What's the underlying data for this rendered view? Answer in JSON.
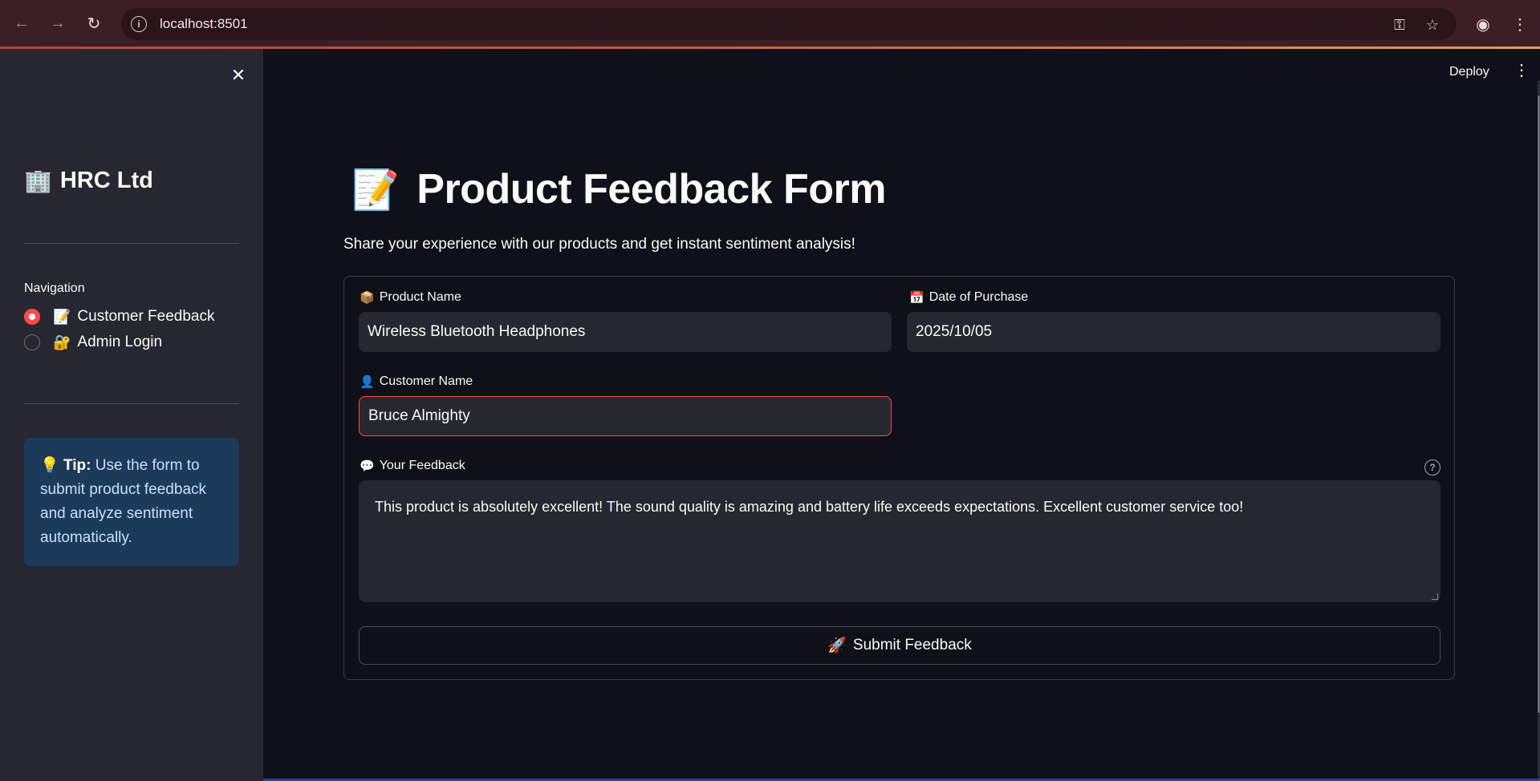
{
  "browser": {
    "url": "localhost:8501"
  },
  "sidebar": {
    "brand_emoji": "🏢",
    "brand_name": "HRC Ltd",
    "nav_label": "Navigation",
    "items": [
      {
        "emoji": "📝",
        "label": "Customer Feedback",
        "selected": true
      },
      {
        "emoji": "🔐",
        "label": "Admin Login",
        "selected": false
      }
    ],
    "tip": {
      "emoji": "💡",
      "bold": "Tip:",
      "text": "Use the form to submit product feedback and analyze sentiment automatically."
    }
  },
  "header": {
    "deploy_label": "Deploy"
  },
  "main": {
    "title_emoji": "📝",
    "title": "Product Feedback Form",
    "subtitle": "Share your experience with our products and get instant sentiment analysis!",
    "form": {
      "product_name": {
        "emoji": "📦",
        "label": "Product Name",
        "value": "Wireless Bluetooth Headphones"
      },
      "date_of_purchase": {
        "emoji": "📅",
        "label": "Date of Purchase",
        "value": "2025/10/05"
      },
      "customer_name": {
        "emoji": "👤",
        "label": "Customer Name",
        "value": "Bruce Almighty"
      },
      "feedback": {
        "emoji": "💬",
        "label": "Your Feedback",
        "value": "This product is absolutely excellent! The sound quality is amazing and battery life exceeds expectations. Excellent customer service too!"
      },
      "submit": {
        "emoji": "🚀",
        "label": "Submit Feedback"
      }
    }
  },
  "colors": {
    "accent": "#ff4b4b",
    "sidebar_bg": "#262730",
    "main_bg": "#0e1117",
    "tip_bg": "#1c3a5a"
  }
}
